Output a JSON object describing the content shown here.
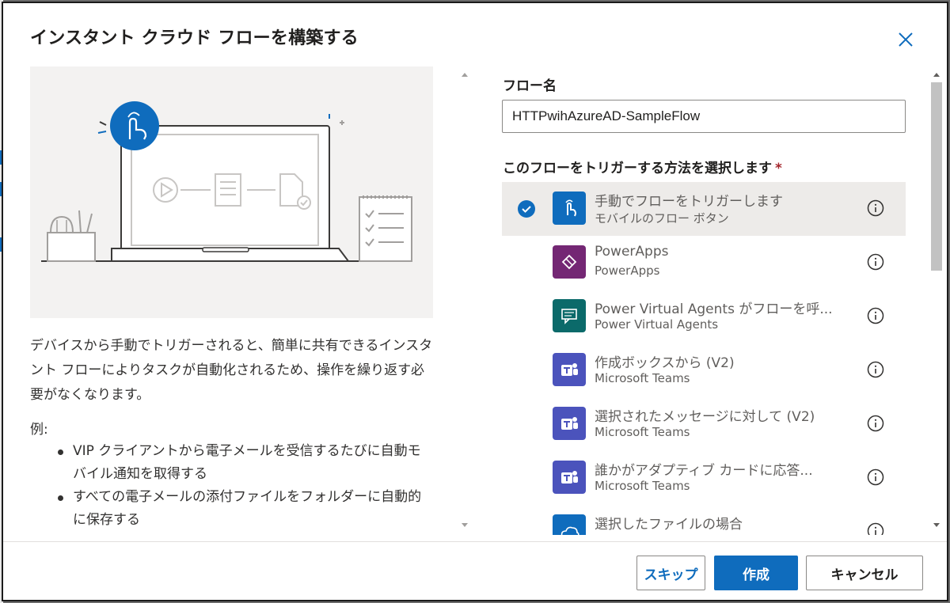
{
  "dialog": {
    "title": "インスタント クラウド フローを構築する"
  },
  "left": {
    "description": "デバイスから手動でトリガーされると、簡単に共有できるインスタント フローによりタスクが自動化されるため、操作を繰り返す必要がなくなります。",
    "examples_label": "例:",
    "examples": [
      "VIP クライアントから電子メールを受信するたびに自動モバイル通知を取得する",
      "すべての電子メールの添付ファイルをフォルダーに自動的に保存する"
    ]
  },
  "form": {
    "flow_name_label": "フロー名",
    "flow_name_value": "HTTPwihAzureAD-SampleFlow",
    "trigger_label": "このフローをトリガーする方法を選択します",
    "required_mark": "*"
  },
  "triggers": [
    {
      "title": "手動でフローをトリガーします",
      "subtitle": "モバイルのフロー ボタン",
      "icon": "hand-tap-icon",
      "color": "#0f6cbd",
      "selected": true
    },
    {
      "title": "PowerApps",
      "subtitle": "PowerApps",
      "icon": "powerapps-icon",
      "color": "#742774",
      "selected": false
    },
    {
      "title": "Power Virtual Agents がフローを呼...",
      "subtitle": "Power Virtual Agents",
      "icon": "chatbot-icon",
      "color": "#0b6a6a",
      "selected": false
    },
    {
      "title": "作成ボックスから (V2)",
      "subtitle": "Microsoft Teams",
      "icon": "teams-icon",
      "color": "#4b53bc",
      "selected": false
    },
    {
      "title": "選択されたメッセージに対して (V2)",
      "subtitle": "Microsoft Teams",
      "icon": "teams-icon",
      "color": "#4b53bc",
      "selected": false
    },
    {
      "title": "誰かがアダプティブ カードに応答...",
      "subtitle": "Microsoft Teams",
      "icon": "teams-icon",
      "color": "#4b53bc",
      "selected": false
    },
    {
      "title": "選択したファイルの場合",
      "subtitle": "",
      "icon": "onedrive-icon",
      "color": "#0f6cbd",
      "selected": false
    }
  ],
  "footer": {
    "skip_label": "スキップ",
    "create_label": "作成",
    "cancel_label": "キャンセル"
  }
}
